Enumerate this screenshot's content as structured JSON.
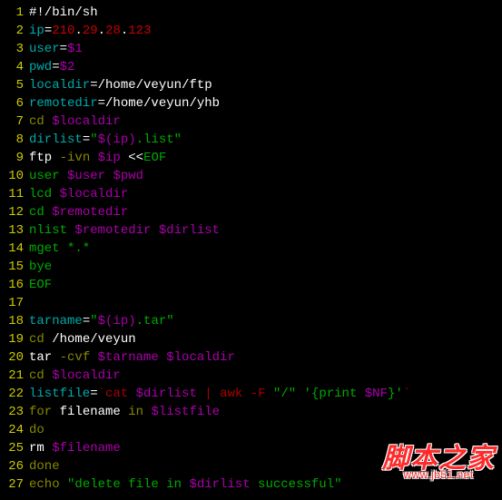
{
  "watermark": {
    "main": "脚本之家",
    "sub": "www.jb51.net"
  },
  "lines": [
    {
      "n": "1",
      "tokens": [
        {
          "t": "#!/bin/sh",
          "c": "white"
        }
      ]
    },
    {
      "n": "2",
      "tokens": [
        {
          "t": "ip",
          "c": "cyan"
        },
        {
          "t": "=",
          "c": "white"
        },
        {
          "t": "210",
          "c": "red"
        },
        {
          "t": ".",
          "c": "white"
        },
        {
          "t": "29",
          "c": "red"
        },
        {
          "t": ".",
          "c": "white"
        },
        {
          "t": "28",
          "c": "red"
        },
        {
          "t": ".",
          "c": "white"
        },
        {
          "t": "123",
          "c": "red"
        }
      ]
    },
    {
      "n": "3",
      "tokens": [
        {
          "t": "user",
          "c": "cyan"
        },
        {
          "t": "=",
          "c": "white"
        },
        {
          "t": "$1",
          "c": "purple"
        }
      ]
    },
    {
      "n": "4",
      "tokens": [
        {
          "t": "pwd",
          "c": "cyan"
        },
        {
          "t": "=",
          "c": "white"
        },
        {
          "t": "$2",
          "c": "purple"
        }
      ]
    },
    {
      "n": "5",
      "tokens": [
        {
          "t": "localdir",
          "c": "cyan"
        },
        {
          "t": "=/home/veyun/ftp",
          "c": "white"
        }
      ]
    },
    {
      "n": "6",
      "tokens": [
        {
          "t": "remotedir",
          "c": "cyan"
        },
        {
          "t": "=/home/veyun/yhb",
          "c": "white"
        }
      ]
    },
    {
      "n": "7",
      "tokens": [
        {
          "t": "cd",
          "c": "yellow"
        },
        {
          "t": " ",
          "c": "white"
        },
        {
          "t": "$localdir",
          "c": "purple"
        }
      ]
    },
    {
      "n": "8",
      "tokens": [
        {
          "t": "dirlist",
          "c": "cyan"
        },
        {
          "t": "=",
          "c": "white"
        },
        {
          "t": "\"",
          "c": "green"
        },
        {
          "t": "$(ip)",
          "c": "purple"
        },
        {
          "t": ".list\"",
          "c": "green"
        }
      ]
    },
    {
      "n": "9",
      "tokens": [
        {
          "t": "ftp ",
          "c": "white"
        },
        {
          "t": "-ivn",
          "c": "yellow"
        },
        {
          "t": " ",
          "c": "white"
        },
        {
          "t": "$ip",
          "c": "purple"
        },
        {
          "t": " <<",
          "c": "white"
        },
        {
          "t": "EOF",
          "c": "green"
        }
      ]
    },
    {
      "n": "10",
      "tokens": [
        {
          "t": "user ",
          "c": "green"
        },
        {
          "t": "$user",
          "c": "purple"
        },
        {
          "t": " ",
          "c": "green"
        },
        {
          "t": "$pwd",
          "c": "purple"
        }
      ]
    },
    {
      "n": "11",
      "tokens": [
        {
          "t": "lcd ",
          "c": "green"
        },
        {
          "t": "$localdir",
          "c": "purple"
        }
      ]
    },
    {
      "n": "12",
      "tokens": [
        {
          "t": "cd ",
          "c": "green"
        },
        {
          "t": "$remotedir",
          "c": "purple"
        }
      ]
    },
    {
      "n": "13",
      "tokens": [
        {
          "t": "nlist ",
          "c": "green"
        },
        {
          "t": "$remotedir",
          "c": "purple"
        },
        {
          "t": " ",
          "c": "green"
        },
        {
          "t": "$dirlist",
          "c": "purple"
        }
      ]
    },
    {
      "n": "14",
      "tokens": [
        {
          "t": "mget *.*",
          "c": "green"
        }
      ]
    },
    {
      "n": "15",
      "tokens": [
        {
          "t": "bye",
          "c": "green"
        }
      ]
    },
    {
      "n": "16",
      "tokens": [
        {
          "t": "EOF",
          "c": "green"
        }
      ]
    },
    {
      "n": "17",
      "tokens": [
        {
          "t": "",
          "c": "white"
        }
      ]
    },
    {
      "n": "18",
      "tokens": [
        {
          "t": "tarname",
          "c": "cyan"
        },
        {
          "t": "=",
          "c": "white"
        },
        {
          "t": "\"",
          "c": "green"
        },
        {
          "t": "$(ip)",
          "c": "purple"
        },
        {
          "t": ".tar\"",
          "c": "green"
        }
      ]
    },
    {
      "n": "19",
      "tokens": [
        {
          "t": "cd",
          "c": "yellow"
        },
        {
          "t": " /home/veyun",
          "c": "white"
        }
      ]
    },
    {
      "n": "20",
      "tokens": [
        {
          "t": "tar ",
          "c": "white"
        },
        {
          "t": "-cvf",
          "c": "yellow"
        },
        {
          "t": " ",
          "c": "white"
        },
        {
          "t": "$tarname",
          "c": "purple"
        },
        {
          "t": " ",
          "c": "white"
        },
        {
          "t": "$localdir",
          "c": "purple"
        }
      ]
    },
    {
      "n": "21",
      "tokens": [
        {
          "t": "cd",
          "c": "yellow"
        },
        {
          "t": " ",
          "c": "white"
        },
        {
          "t": "$localdir",
          "c": "purple"
        }
      ]
    },
    {
      "n": "22",
      "tokens": [
        {
          "t": "listfile",
          "c": "cyan"
        },
        {
          "t": "=",
          "c": "white"
        },
        {
          "t": "`",
          "c": "dred"
        },
        {
          "t": "cat ",
          "c": "dred"
        },
        {
          "t": "$dirlist",
          "c": "purple"
        },
        {
          "t": " | ",
          "c": "dred"
        },
        {
          "t": "awk",
          "c": "dred"
        },
        {
          "t": " ",
          "c": "dred"
        },
        {
          "t": "-F",
          "c": "dred"
        },
        {
          "t": " ",
          "c": "dred"
        },
        {
          "t": "\"/\"",
          "c": "green"
        },
        {
          "t": " ",
          "c": "dred"
        },
        {
          "t": "'{print ",
          "c": "green"
        },
        {
          "t": "$NF",
          "c": "purple"
        },
        {
          "t": "}'",
          "c": "green"
        },
        {
          "t": "`",
          "c": "dred"
        }
      ]
    },
    {
      "n": "23",
      "tokens": [
        {
          "t": "for",
          "c": "yellow"
        },
        {
          "t": " filename ",
          "c": "white"
        },
        {
          "t": "in",
          "c": "yellow"
        },
        {
          "t": " ",
          "c": "white"
        },
        {
          "t": "$listfile",
          "c": "purple"
        }
      ]
    },
    {
      "n": "24",
      "tokens": [
        {
          "t": "do",
          "c": "yellow"
        }
      ]
    },
    {
      "n": "25",
      "tokens": [
        {
          "t": "rm ",
          "c": "white"
        },
        {
          "t": "$filename",
          "c": "purple"
        }
      ]
    },
    {
      "n": "26",
      "tokens": [
        {
          "t": "done",
          "c": "yellow"
        }
      ]
    },
    {
      "n": "27",
      "tokens": [
        {
          "t": "echo",
          "c": "yellow"
        },
        {
          "t": " ",
          "c": "white"
        },
        {
          "t": "\"delete file in ",
          "c": "green"
        },
        {
          "t": "$dirlist",
          "c": "purple"
        },
        {
          "t": " successful\"",
          "c": "green"
        }
      ]
    }
  ]
}
